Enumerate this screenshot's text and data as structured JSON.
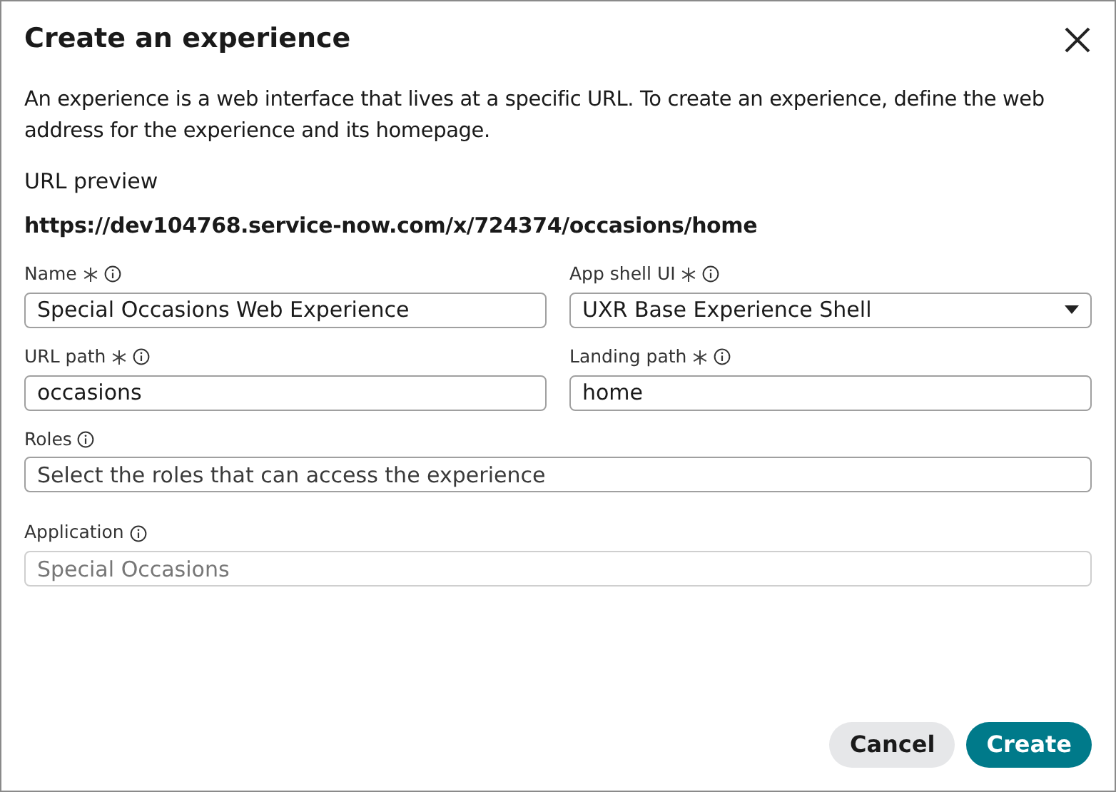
{
  "dialog": {
    "title": "Create an experience",
    "description": "An experience is a web interface that lives at a specific URL. To create an experience, define the web address for the experience and its homepage.",
    "url_preview_label": "URL preview",
    "url_preview": "https://dev104768.service-now.com/x/724374/occasions/home"
  },
  "fields": [
    {
      "label": "Name",
      "required": true,
      "kind": "text",
      "value": "Special Occasions Web Experience"
    },
    {
      "label": "App shell UI",
      "required": true,
      "kind": "select",
      "value": "UXR Base Experience Shell"
    },
    {
      "label": "URL path",
      "required": true,
      "kind": "text",
      "value": "occasions"
    },
    {
      "label": "Landing path",
      "required": true,
      "kind": "text",
      "value": "home"
    },
    {
      "label": "Roles",
      "required": false,
      "kind": "wide-text",
      "placeholder": "Select the roles that can access the experience"
    },
    {
      "label": "Application",
      "required": false,
      "kind": "wide-text",
      "value": "Special Occasions",
      "disabled": true
    }
  ],
  "buttons": [
    {
      "label": "Cancel",
      "kind": "secondary"
    },
    {
      "label": "Create",
      "kind": "primary"
    }
  ]
}
